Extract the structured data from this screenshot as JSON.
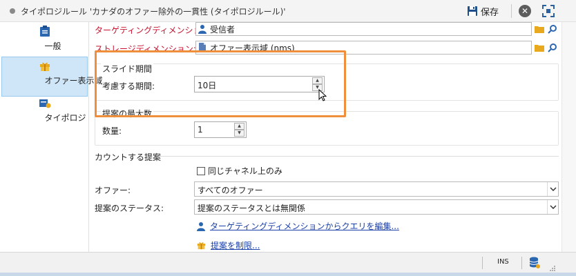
{
  "window": {
    "title": "タイポロジルール 'カナダのオファー除外の一貫性 (タイポロジルール)'",
    "save_label": "保存"
  },
  "sidebar": {
    "items": [
      {
        "label": "一般"
      },
      {
        "label": "オファー表示域"
      },
      {
        "label": "タイポロジ"
      }
    ]
  },
  "form": {
    "targeting_dimension": {
      "label": "ターゲティングディメンション:",
      "value": "受信者"
    },
    "storage_dimension": {
      "label": "ストレージディメンション:",
      "value": "オファー表示域 (nms)"
    },
    "slide_period": {
      "group_label": "スライド期間",
      "label": "考慮する期間:",
      "value": "10日"
    },
    "max_proposals": {
      "group_label": "提案の最大数",
      "label": "数量:",
      "value": "1"
    },
    "counted_proposals": {
      "section_label": "カウントする提案",
      "same_channel_label": "同じチャネル上のみ",
      "offer_label": "オファー:",
      "offer_value": "すべてのオファー",
      "status_label": "提案のステータス:",
      "status_value": "提案のステータスとは無関係"
    },
    "links": {
      "edit_query": "ターゲティングディメンションからクエリを編集...",
      "restrict": "提案を制限..."
    }
  },
  "status": {
    "mode": "INS"
  },
  "colors": {
    "accent": "#ef8e3b",
    "required_label": "#c8102e",
    "selected_nav": "#cfe6f8",
    "link": "#1a3fa8"
  },
  "icons": {
    "save": "floppy-disk-icon",
    "close": "close-icon",
    "maximize": "maximize-icon",
    "general": "clipboard-icon",
    "offer_space": "gift-icon",
    "typology": "typology-icon",
    "recipient": "person-icon",
    "storage": "document-icon",
    "folder": "folder-icon",
    "search": "search-icon",
    "database": "database-icon"
  }
}
